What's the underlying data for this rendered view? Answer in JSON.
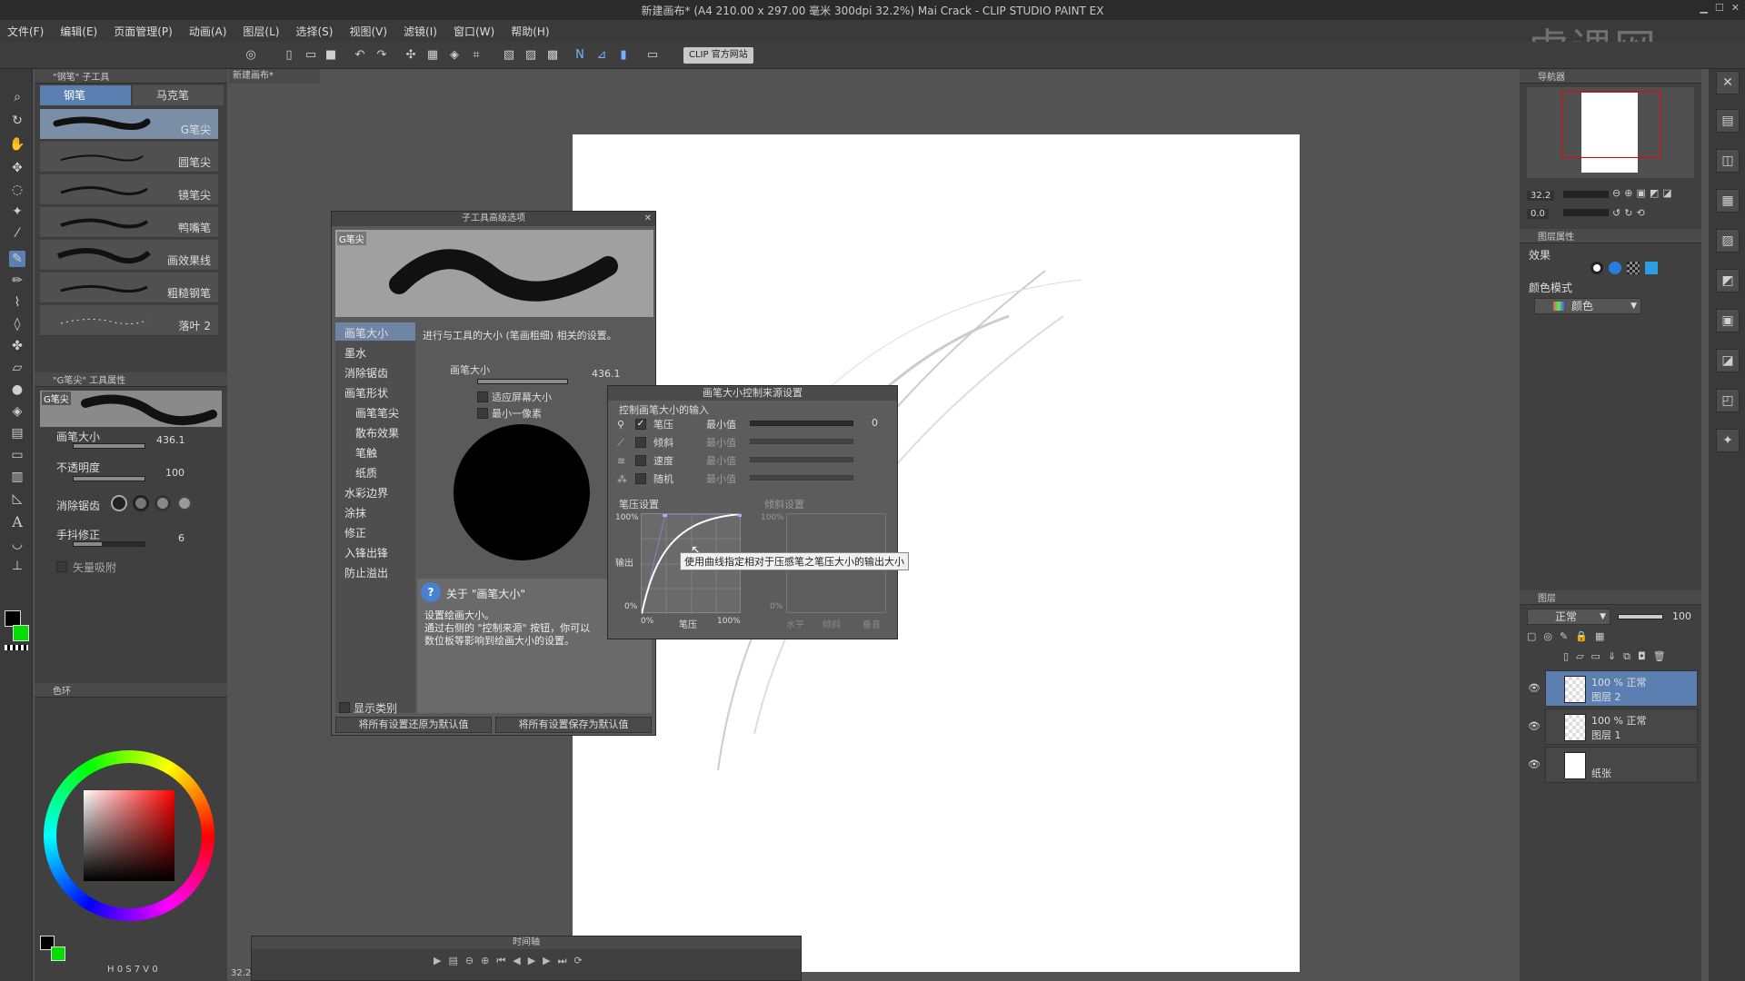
{
  "title": "新建画布* (A4 210.00 x 297.00 毫米 300dpi 32.2%)  Mai Crack - CLIP STUDIO PAINT EX",
  "menu": [
    "文件(F)",
    "编辑(E)",
    "页面管理(P)",
    "动画(A)",
    "图层(L)",
    "选择(S)",
    "视图(V)",
    "滤镜(I)",
    "窗口(W)",
    "帮助(H)"
  ],
  "toolbar": {
    "clip_site": "CLIP 官方网站"
  },
  "watermark": "虎课网",
  "doc_tab": "新建画布*",
  "subtool_panel": {
    "header": "\"钢笔\" 子工具",
    "tabs": [
      "钢笔",
      "马克笔"
    ],
    "brushes": [
      "G笔尖",
      "圆笔尖",
      "镜笔尖",
      "鸭嘴笔",
      "画效果线",
      "粗糙钢笔",
      "落叶 2"
    ]
  },
  "tool_property": {
    "header": "\"G笔尖\" 工具属性",
    "preview_label": "G笔尖",
    "brush_size_label": "画笔大小",
    "brush_size_value": "436.1",
    "opacity_label": "不透明度",
    "opacity_value": "100",
    "antialias_label": "消除锯齿",
    "stabilize_label": "手抖修正",
    "stabilize_value": "6",
    "vector_snap_label": "矢量吸附"
  },
  "color_panel": {
    "tab": "色环",
    "status": "H 0 S 7 V 0"
  },
  "subtool_dialog": {
    "title": "子工具高级选项",
    "preview_label": "G笔尖",
    "categories": [
      "画笔大小",
      "墨水",
      "消除锯齿",
      "画笔形状",
      "画笔笔尖",
      "散布效果",
      "笔触",
      "纸质",
      "水彩边界",
      "涂抹",
      "修正",
      "入锋出锋",
      "防止溢出"
    ],
    "description": "进行与工具的大小 (笔画粗细) 相关的设置。",
    "size_label": "画笔大小",
    "size_value": "436.1",
    "fit_screen": "适应屏幕大小",
    "min_pixel": "最小一像素",
    "help_title": "关于 \"画笔大小\"",
    "help_text_1": "设置绘画大小。",
    "help_text_2": "通过右侧的 \"控制来源\" 按钮，你可以",
    "help_text_3": "数位板等影响到绘画大小的设置。",
    "show_category": "显示类别",
    "reset_btn": "将所有设置还原为默认值",
    "save_btn": "将所有设置保存为默认值"
  },
  "pressure_dialog": {
    "title": "画笔大小控制来源设置",
    "section": "控制画笔大小的输入",
    "inputs": [
      {
        "label": "笔压",
        "checked": true,
        "min": "最小值",
        "value": "0"
      },
      {
        "label": "倾斜",
        "checked": false,
        "min": "最小值"
      },
      {
        "label": "速度",
        "checked": false,
        "min": "最小值"
      },
      {
        "label": "随机",
        "checked": false,
        "min": "最小值"
      }
    ],
    "pressure_settings": "笔压设置",
    "tilt_settings": "倾斜设置",
    "y_top": "100%",
    "y_bottom": "0%",
    "y_label": "输出",
    "x_left": "0%",
    "x_mid": "笔压",
    "x_right": "100%",
    "tilt_y_top": "100%",
    "tilt_y_bottom": "0%",
    "tilt_x": [
      "水平",
      "倾斜",
      "垂直"
    ],
    "tooltip": "使用曲线指定相对于压感笔之笔压大小的输出大小"
  },
  "navigator": {
    "tab": "导航器",
    "zoom": "32.2",
    "angle": "0.0"
  },
  "layer_property": {
    "tab": "图层属性",
    "effect": "效果",
    "color_mode_label": "颜色模式",
    "color_mode": "颜色"
  },
  "layers": {
    "tab": "图层",
    "blend": "正常",
    "opacity": "100",
    "items": [
      {
        "meta": "100 % 正常",
        "name": "图层 2"
      },
      {
        "meta": "100 % 正常",
        "name": "图层 1"
      },
      {
        "meta": "",
        "name": "纸张"
      }
    ]
  },
  "timeline": {
    "title": "时间轴"
  },
  "zoom_status": "32.2"
}
